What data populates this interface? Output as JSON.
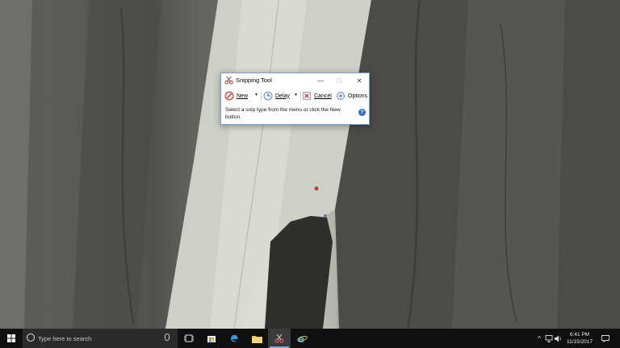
{
  "window": {
    "title": "Snipping Tool",
    "minimize_glyph": "—",
    "maximize_glyph": "☐",
    "close_glyph": "✕",
    "toolbar": {
      "new_label": "New",
      "delay_label": "Delay",
      "cancel_label": "Cancel",
      "options_label": "Options"
    },
    "message": "Select a snip type from the menu or click the New button.",
    "help_glyph": "?"
  },
  "taskbar": {
    "search_placeholder": "Type here to search",
    "apps": [
      "task-view",
      "store",
      "edge",
      "file-explorer",
      "snipping-tool",
      "internet-explorer"
    ],
    "tray_chevron": "^",
    "clock_time": "6:41 PM",
    "clock_date": "11/15/2017"
  },
  "colors": {
    "accent": "#2e6fc4",
    "taskbar": "#101010",
    "window_border": "#7a9fc9"
  }
}
